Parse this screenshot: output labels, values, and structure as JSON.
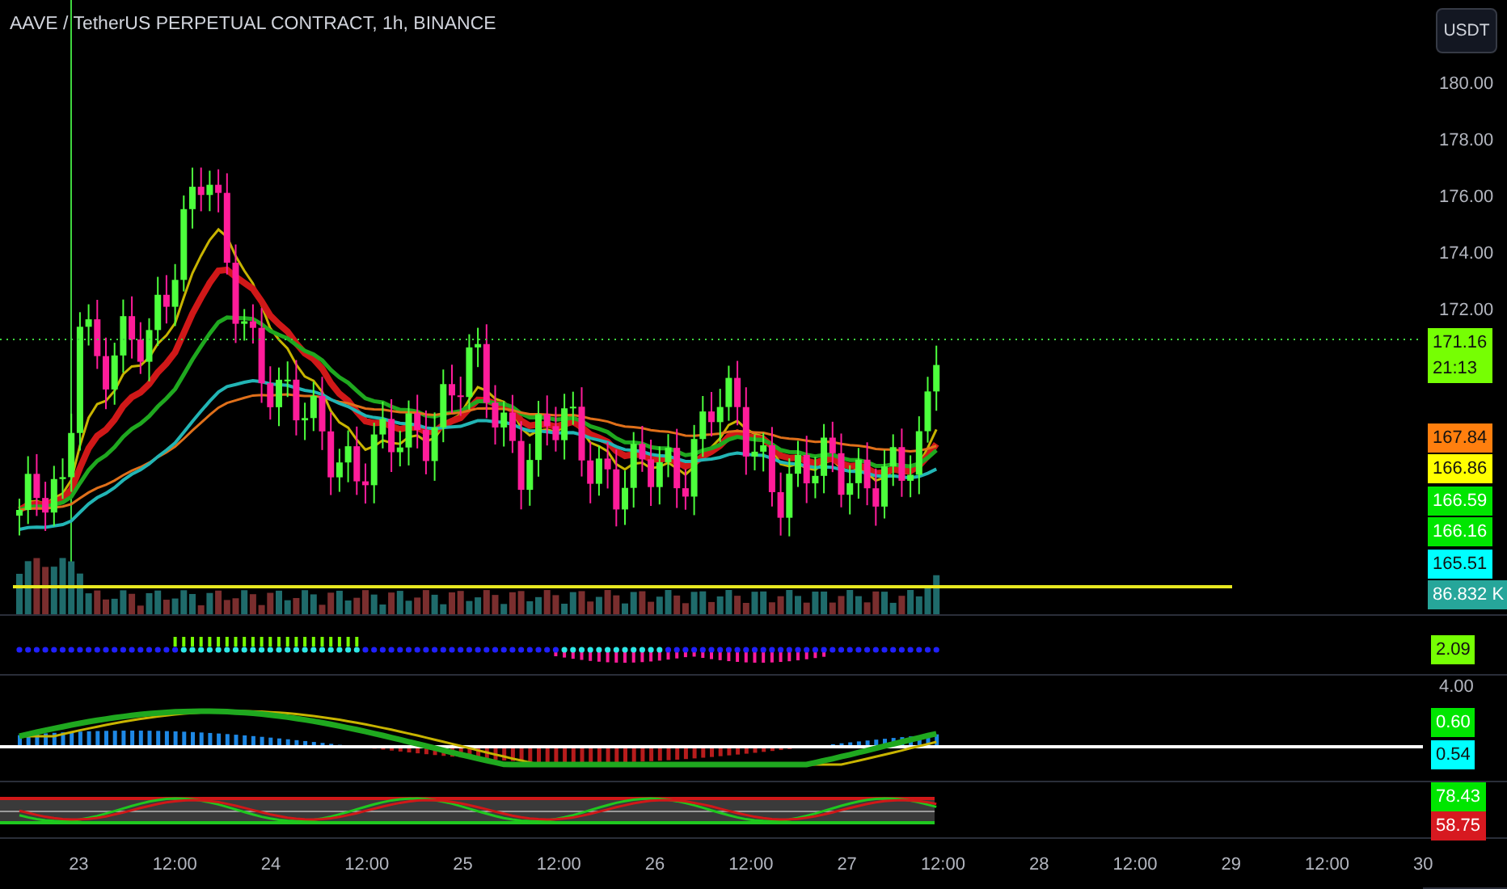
{
  "header": {
    "title": "AAVE / TetherUS PERPETUAL CONTRACT, 1h, BINANCE"
  },
  "currency_button": "USDT",
  "price_axis": {
    "ticks": [
      "180.00",
      "178.00",
      "176.00",
      "174.00",
      "172.00"
    ],
    "badges": [
      {
        "text": "171.16",
        "subtext": "21:13",
        "color": "#76ff03"
      },
      {
        "text": "167.84",
        "color": "#ff7f0e"
      },
      {
        "text": "166.86",
        "color": "#ffff00"
      },
      {
        "text": "166.59",
        "color": "#00e600"
      },
      {
        "text": "166.16",
        "color": "#00e600"
      },
      {
        "text": "165.51",
        "color": "#00ffff"
      },
      {
        "text": "86.832 K",
        "color": "#26a69a"
      }
    ]
  },
  "oscillator_pane": {
    "badges": [
      {
        "text": "2.09",
        "color": "#76ff03"
      }
    ]
  },
  "macd_pane": {
    "tick": "4.00",
    "badges": [
      {
        "text": "0.60",
        "color": "#00e600"
      },
      {
        "text": "0.54",
        "color": "#00ffff"
      }
    ]
  },
  "rsi_pane": {
    "badges": [
      {
        "text": "78.43",
        "color": "#00e600"
      },
      {
        "text": "58.75",
        "color": "#d71920"
      }
    ]
  },
  "time_axis": {
    "labels": [
      "23",
      "12:00",
      "24",
      "12:00",
      "25",
      "12:00",
      "26",
      "12:00",
      "27",
      "12:00",
      "28",
      "12:00",
      "29",
      "12:00",
      "30"
    ]
  }
}
